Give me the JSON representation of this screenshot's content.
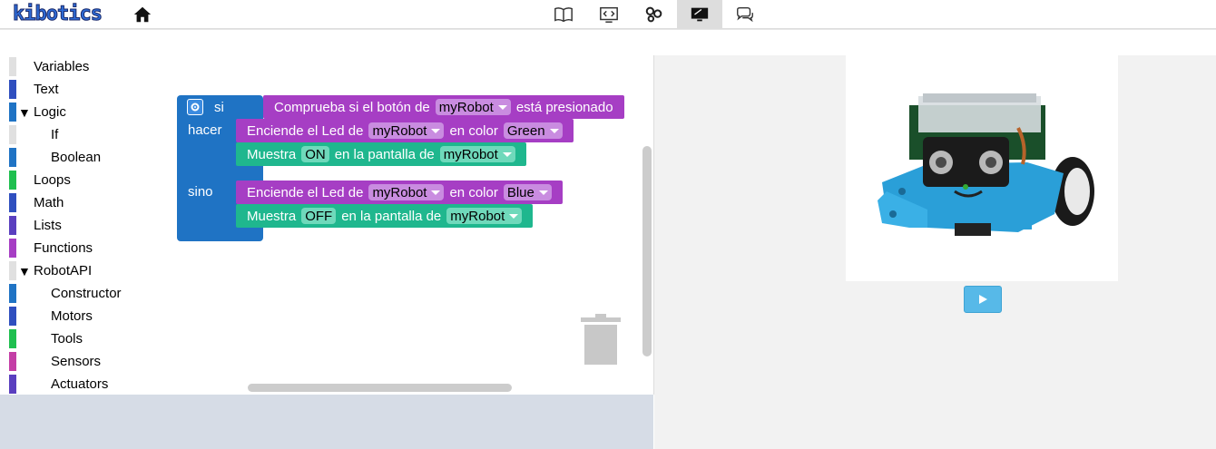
{
  "header": {
    "logo_text": "kibotics",
    "nav_icons": [
      "home-icon",
      "book-icon",
      "code-icon",
      "robot-parts-icon",
      "screen-icon",
      "chat-icon"
    ]
  },
  "toolbox": {
    "items": [
      {
        "label": "Variables",
        "color": "#e0e0e0",
        "expanded": null,
        "indent": 0
      },
      {
        "label": "Text",
        "color": "#2f4fbf",
        "expanded": null,
        "indent": 0
      },
      {
        "label": "Logic",
        "color": "#1f73c4",
        "expanded": true,
        "indent": 0
      },
      {
        "label": "If",
        "color": "#e0e0e0",
        "expanded": null,
        "indent": 1
      },
      {
        "label": "Boolean",
        "color": "#1f73c4",
        "expanded": null,
        "indent": 1
      },
      {
        "label": "Loops",
        "color": "#1fbf4f",
        "expanded": null,
        "indent": 0
      },
      {
        "label": "Math",
        "color": "#2f4fbf",
        "expanded": null,
        "indent": 0
      },
      {
        "label": "Lists",
        "color": "#5a3fbf",
        "expanded": null,
        "indent": 0
      },
      {
        "label": "Functions",
        "color": "#a63ec4",
        "expanded": null,
        "indent": 0
      },
      {
        "label": "RobotAPI",
        "color": "#e0e0e0",
        "expanded": true,
        "indent": 0
      },
      {
        "label": "Constructor",
        "color": "#1f73c4",
        "expanded": null,
        "indent": 1
      },
      {
        "label": "Motors",
        "color": "#2f4fbf",
        "expanded": null,
        "indent": 1
      },
      {
        "label": "Tools",
        "color": "#1fbf4f",
        "expanded": null,
        "indent": 1
      },
      {
        "label": "Sensors",
        "color": "#c43ea6",
        "expanded": null,
        "indent": 1
      },
      {
        "label": "Actuators",
        "color": "#5a3fbf",
        "expanded": null,
        "indent": 1
      }
    ]
  },
  "workspace": {
    "if_block": {
      "si": "si",
      "hacer": "hacer",
      "sino": "sino"
    },
    "condition": {
      "prefix": "Comprueba si el botón de",
      "robot": "myRobot",
      "suffix": "está presionado"
    },
    "led_on": {
      "prefix": "Enciende el Led de",
      "robot": "myRobot",
      "mid": "en color",
      "color": "Green"
    },
    "show_on": {
      "prefix": "Muestra",
      "value": "ON",
      "mid": "en la pantalla de",
      "robot": "myRobot"
    },
    "led_off": {
      "prefix": "Enciende el Led de",
      "robot": "myRobot",
      "mid": "en color",
      "color": "Blue"
    },
    "show_off": {
      "prefix": "Muestra",
      "value": "OFF",
      "mid": "en la pantalla de",
      "robot": "myRobot"
    }
  },
  "colors": {
    "logic_blue": "#1f73c4",
    "action_purple": "#a63ec4",
    "display_teal": "#1fb78e",
    "play_button": "#57b9e8"
  }
}
